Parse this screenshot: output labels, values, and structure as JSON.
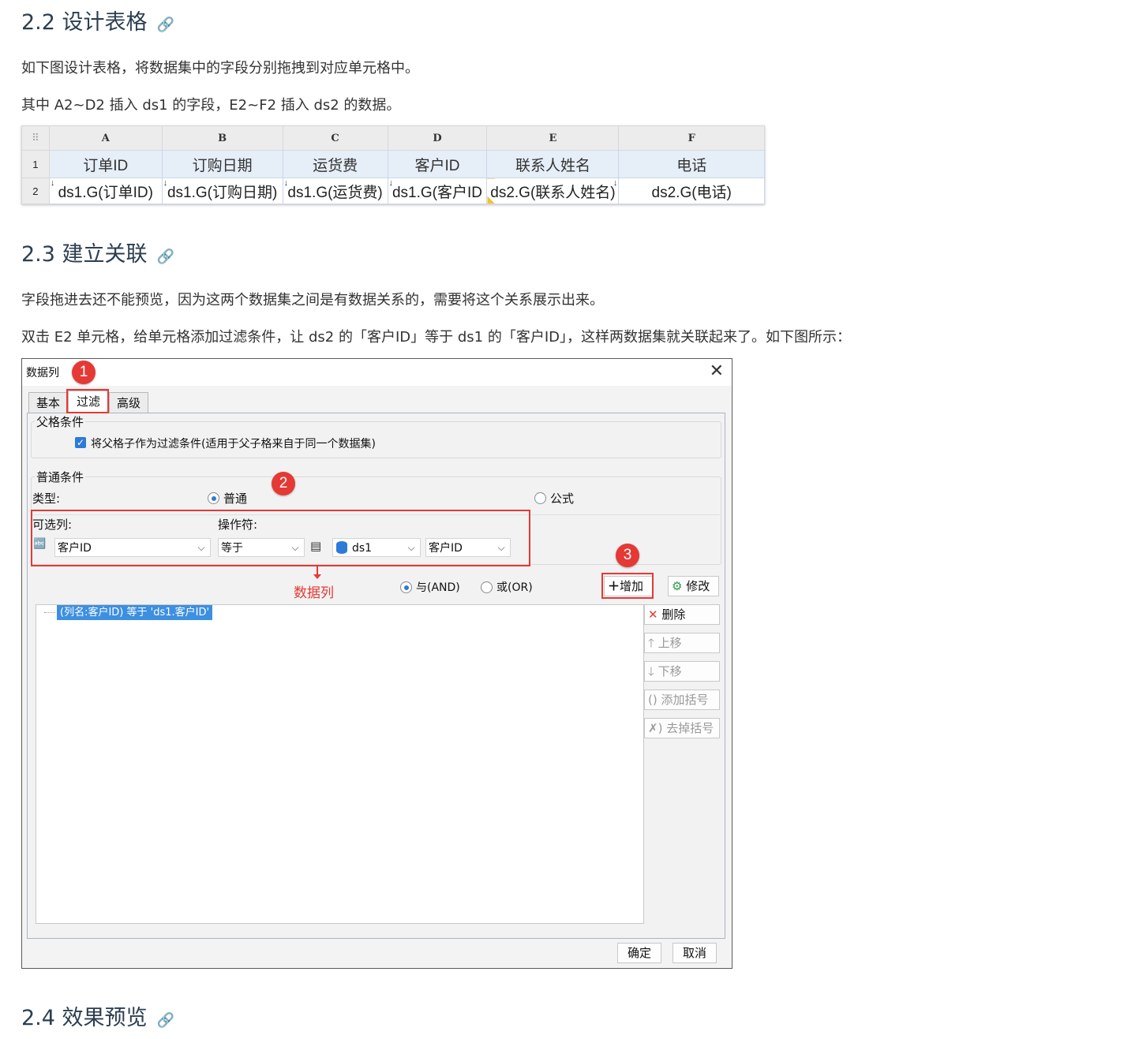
{
  "sections": {
    "s22": {
      "title": "2.2 设计表格",
      "link_icon": "link-icon"
    },
    "s23": {
      "title": "2.3 建立关联",
      "link_icon": "link-icon"
    },
    "s24": {
      "title": "2.4 效果预览",
      "link_icon": "link-icon"
    }
  },
  "paragraphs": {
    "p1": "如下图设计表格，将数据集中的字段分别拖拽到对应单元格中。",
    "p2": "其中 A2~D2 插入 ds1 的字段，E2~F2 插入 ds2 的数据。",
    "p3": "字段拖进去还不能预览，因为这两个数据集之间是有数据关系的，需要将这个关系展示出来。",
    "p4": "双击 E2 单元格，给单元格添加过滤条件，让 ds2 的「客户ID」等于 ds1 的「客户ID」，这样两数据集就关联起来了。如下图所示："
  },
  "sheet": {
    "corner": "⠿",
    "columns": [
      "A",
      "B",
      "C",
      "D",
      "E",
      "F"
    ],
    "rows": [
      {
        "num": "1",
        "cells": [
          "订单ID",
          "订购日期",
          "运货费",
          "客户ID",
          "联系人姓名",
          "电话"
        ]
      },
      {
        "num": "2",
        "cells": [
          "ds1.G(订单ID)",
          "ds1.G(订购日期)",
          "ds1.G(运货费)",
          "ds1.G(客户ID",
          "ds2.G(联系人姓名)",
          "ds2.G(电话)"
        ]
      }
    ],
    "expand_mark": "↓"
  },
  "dialog": {
    "title": "数据列",
    "close": "✕",
    "tabs": [
      "基本",
      "过滤",
      "高级"
    ],
    "parent_group": "父格条件",
    "parent_checkbox": "将父格子作为过滤条件(适用于父子格来自于同一个数据集)",
    "normal_group": "普通条件",
    "type_label": "类型:",
    "type_normal": "普通",
    "type_formula": "公式",
    "column_label": "可选列:",
    "operator_label": "操作符:",
    "column_value": "客户ID",
    "operator_value": "等于",
    "dataset_value": "ds1",
    "field_value": "客户ID",
    "and_label": "与(AND)",
    "or_label": "或(OR)",
    "add_button": "增加",
    "modify_button": "修改",
    "delete_button": "删除",
    "up_button": "上移",
    "down_button": "下移",
    "add_paren_button": "添加括号",
    "remove_paren_button": "去掉括号",
    "condition_item": "(列名:客户ID) 等于 'ds1.客户ID'",
    "ok": "确定",
    "cancel": "取消"
  },
  "annotations": {
    "b1": "1",
    "b2": "2",
    "b3": "3",
    "data_col": "数据列",
    "accent": "#e53935"
  }
}
